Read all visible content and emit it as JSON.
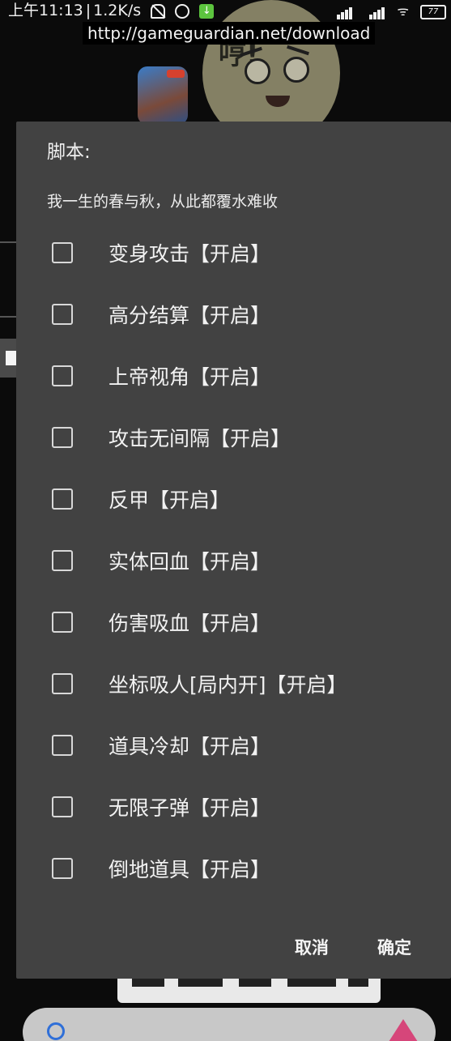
{
  "status_bar": {
    "time": "上午11:13",
    "net_speed": "1.2K/s",
    "battery": "77",
    "download_badge": "↓",
    "wifi_glyph": "ᯤ"
  },
  "url_banner": "http://gameguardian.net/download",
  "background": {
    "shout_text": "哼!"
  },
  "dialog": {
    "title": "脚本:",
    "subtitle": "我一生的春与秋，从此都覆水难收",
    "options": [
      {
        "label": "变身攻击【开启】",
        "checked": false
      },
      {
        "label": "高分结算【开启】",
        "checked": false
      },
      {
        "label": "上帝视角【开启】",
        "checked": false
      },
      {
        "label": "攻击无间隔【开启】",
        "checked": false
      },
      {
        "label": "反甲【开启】",
        "checked": false
      },
      {
        "label": "实体回血【开启】",
        "checked": false
      },
      {
        "label": "伤害吸血【开启】",
        "checked": false
      },
      {
        "label": "坐标吸人[局内开]【开启】",
        "checked": false
      },
      {
        "label": "道具冷却【开启】",
        "checked": false
      },
      {
        "label": "无限子弹【开启】",
        "checked": false
      },
      {
        "label": "倒地道具【开启】",
        "checked": false
      }
    ],
    "cancel_label": "取消",
    "ok_label": "确定"
  },
  "colors": {
    "dialog_bg": "#424242",
    "text": "#f0f0f0",
    "checkbox_border": "#d8d8d8",
    "float_button": "#4a4a4a"
  }
}
